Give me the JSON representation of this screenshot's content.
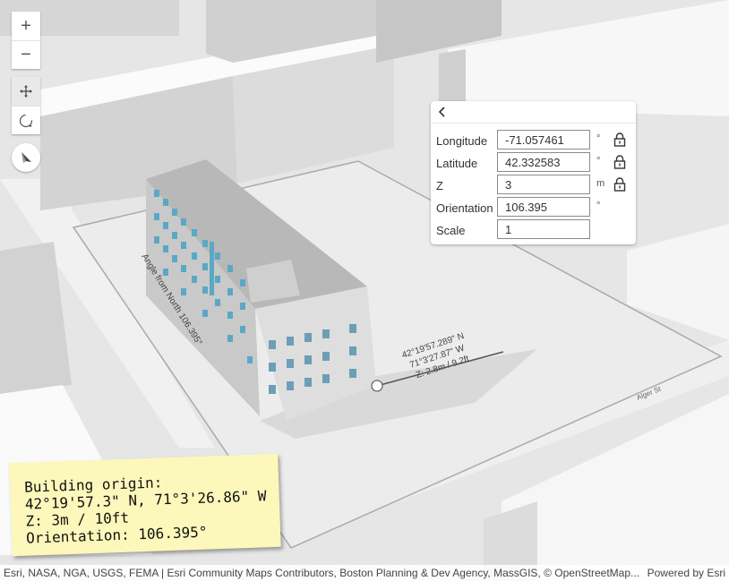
{
  "map_controls": {
    "zoom_in_icon": "plus-icon",
    "zoom_out_icon": "minus-icon",
    "pan_icon": "move-icon",
    "rotate_icon": "rotate-icon",
    "compass_icon": "compass-icon"
  },
  "scene_labels": {
    "angle_label": "Angle from North 106.395°",
    "coord_line1": "42°19'57.289\" N",
    "coord_line2": "71°3'27.87\" W",
    "coord_line3": "Z: 2.8m / 9.2ft",
    "street_label": "Alger St"
  },
  "panel": {
    "back_icon": "chevron-left-icon",
    "rows": [
      {
        "label": "Longitude",
        "value": "-71.057461",
        "unit": "°",
        "locked": true
      },
      {
        "label": "Latitude",
        "value": "42.332583",
        "unit": "°",
        "locked": true
      },
      {
        "label": "Z",
        "value": "3",
        "unit": "m",
        "locked": true
      },
      {
        "label": "Orientation",
        "value": "106.395",
        "unit": "°",
        "locked": false
      },
      {
        "label": "Scale",
        "value": "1",
        "unit": "",
        "locked": false
      }
    ]
  },
  "note": {
    "line1": "Building origin:",
    "line2": "42°19'57.3\" N, 71°3'26.86\" W",
    "line3": "Z: 3m / 10ft",
    "line4": "Orientation: 106.395°"
  },
  "attribution": {
    "sources": "Esri, NASA, NGA, USGS, FEMA | Esri Community Maps Contributors, Boston Planning & Dev Agency, MassGIS, © OpenStreetMap...",
    "powered": "Powered by Esri"
  },
  "colors": {
    "window_blue": "#5aa8c4",
    "note_yellow": "#fcf8bb"
  }
}
